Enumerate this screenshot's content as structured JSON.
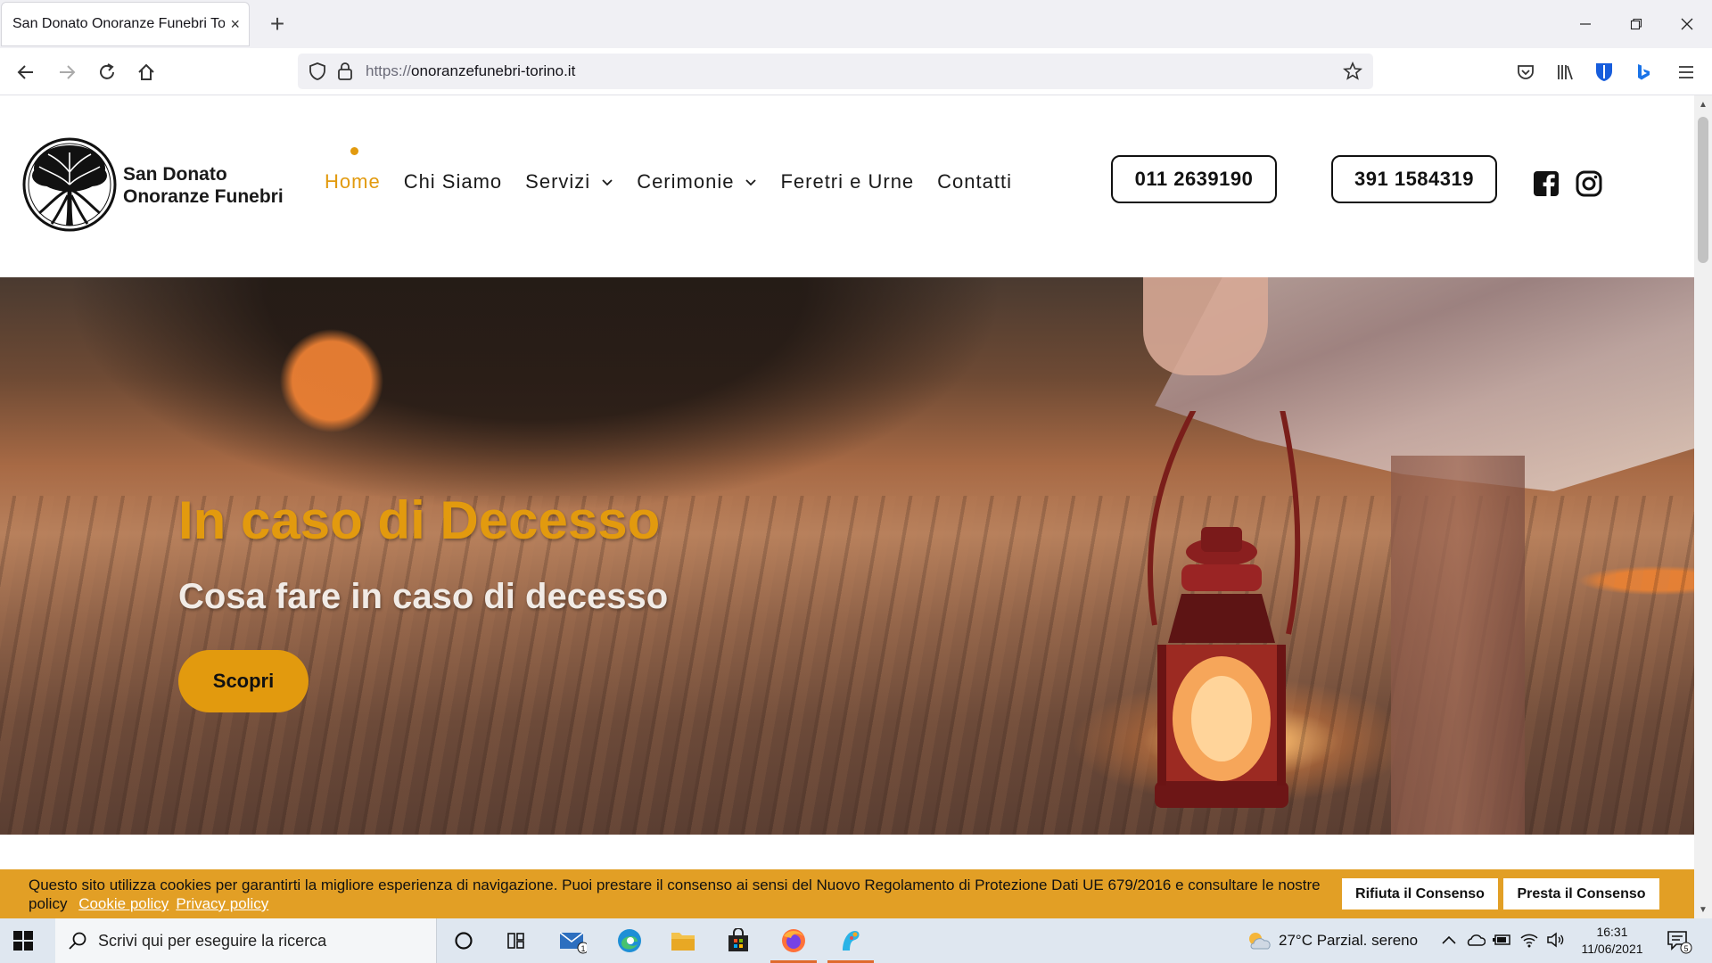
{
  "browser": {
    "tab_title": "San Donato Onoranze Funebri Torino",
    "tab_close": "×",
    "new_tab": "+",
    "url_protocol": "https://",
    "url_host": "onoranzefunebri-torino.it"
  },
  "site": {
    "logo_line1": "San Donato",
    "logo_line2": "Onoranze Funebri",
    "menu": [
      {
        "label": "Home",
        "active": true
      },
      {
        "label": "Chi Siamo"
      },
      {
        "label": "Servizi",
        "dropdown": true
      },
      {
        "label": "Cerimonie",
        "dropdown": true
      },
      {
        "label": "Feretri e Urne"
      },
      {
        "label": "Contatti"
      }
    ],
    "phone1": "011 2639190",
    "phone2": "391 1584319",
    "accent_color": "#e29a0e"
  },
  "hero": {
    "title": "In caso di Decesso",
    "subtitle": "Cosa fare in caso di decesso",
    "button": "Scopri"
  },
  "cookie": {
    "text": "Questo sito utilizza cookies per garantirti la migliore esperienza di navigazione. Puoi prestare il consenso ai sensi del Nuovo Regolamento di Protezione Dati UE 679/2016 e consultare le nostre policy",
    "link1": "Cookie policy",
    "link2": "Privacy policy",
    "reject": "Rifiuta il Consenso",
    "accept": "Presta il Consenso",
    "bar_color": "#e29f25"
  },
  "taskbar": {
    "search_placeholder": "Scrivi qui per eseguire la ricerca",
    "mail_badge": "1",
    "weather": "27°C  Parzial. sereno",
    "time": "16:31",
    "date": "11/06/2021",
    "notification_count": "5"
  }
}
